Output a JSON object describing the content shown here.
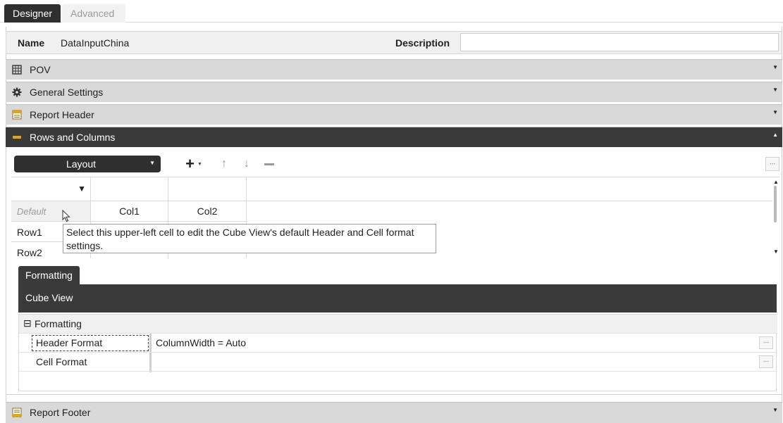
{
  "tabs": {
    "designer": "Designer",
    "advanced": "Advanced"
  },
  "header": {
    "name_label": "Name",
    "name_value": "DataInputChina",
    "description_label": "Description",
    "description_value": ""
  },
  "sections": {
    "pov": {
      "label": "POV",
      "icon": "pov-grid-icon"
    },
    "general": {
      "label": "General Settings",
      "icon": "gear-icon"
    },
    "report_header": {
      "label": "Report Header",
      "icon": "report-header-icon"
    },
    "rows_columns": {
      "label": "Rows and Columns",
      "icon": "rows-columns-icon"
    },
    "report_footer": {
      "label": "Report Footer",
      "icon": "report-footer-icon"
    }
  },
  "toolbar": {
    "layout_label": "Layout",
    "ellipsis": "..."
  },
  "grid": {
    "default_label": "Default",
    "columns": [
      "Col1",
      "Col2"
    ],
    "rows": [
      "Row1",
      "Row2"
    ]
  },
  "tooltip": {
    "text": "Select this upper-left cell to edit the Cube View's default Header and Cell format settings."
  },
  "formatting": {
    "tab_label": "Formatting",
    "bar_title": "Cube View",
    "group_label": "Formatting",
    "group_toggle": "⊟",
    "properties": [
      {
        "name": "Header Format",
        "value": "ColumnWidth = Auto"
      },
      {
        "name": "Cell Format",
        "value": ""
      }
    ],
    "ellipsis": "..."
  },
  "colors": {
    "dark": "#3a3a3a",
    "section": "#d9d9d9",
    "accent_icon": "#e8a400"
  }
}
